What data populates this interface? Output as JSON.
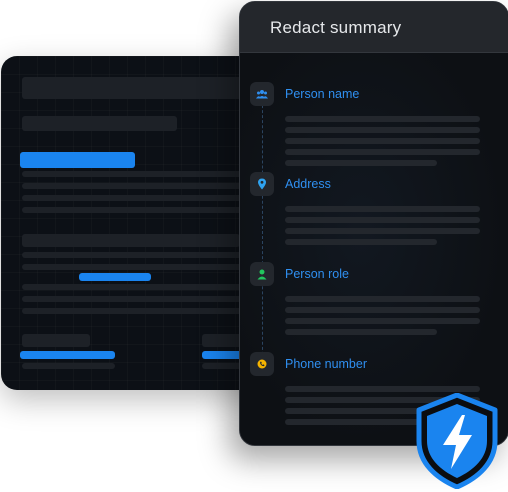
{
  "summary_panel": {
    "title": "Redact summary",
    "sections": [
      {
        "label": "Person name",
        "icon": "people-icon",
        "icon_color": "#2f8ff0"
      },
      {
        "label": "Address",
        "icon": "location-pin-icon",
        "icon_color": "#2fa3f0"
      },
      {
        "label": "Person role",
        "icon": "person-icon",
        "icon_color": "#22c55e"
      },
      {
        "label": "Phone number",
        "icon": "phone-icon",
        "icon_color": "#f5b300"
      }
    ]
  },
  "shield_badge": {
    "icon": "lightning-bolt-icon",
    "color": "#1a84ef"
  },
  "colors": {
    "accent": "#1a84ef",
    "label_blue": "#2f8ff0",
    "panel_bg": "#0d1014",
    "header_bg": "#24272c"
  }
}
